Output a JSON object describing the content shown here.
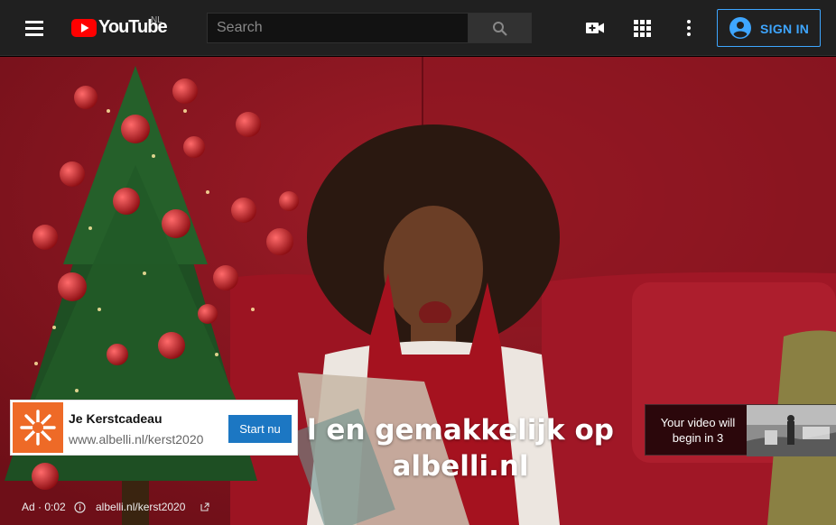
{
  "masthead": {
    "logo_text": "YouTube",
    "country_code": "NL",
    "search_placeholder": "Search",
    "signin_label": "SIGN IN",
    "icons": {
      "menu": "hamburger-menu-icon",
      "search": "search-icon",
      "create": "video-camera-plus-icon",
      "apps": "apps-grid-icon",
      "settings": "vertical-dots-icon",
      "account": "account-circle-icon"
    }
  },
  "player": {
    "subtitle_line1": "l en gemakkelijk op",
    "subtitle_line2": "albelli.nl",
    "ad_card": {
      "title": "Je Kerstcadeau",
      "url": "www.albelli.nl/kerst2020",
      "cta_label": "Start nu",
      "thumb_icon": "albelli-logo-icon"
    },
    "skip": {
      "text": "Your video will begin in 3"
    },
    "ad_info": {
      "label": "Ad · 0:02",
      "link": "albelli.nl/kerst2020",
      "info_icon": "info-icon",
      "external_icon": "external-link-icon"
    }
  },
  "colors": {
    "masthead_bg": "#202020",
    "accent_blue": "#3ea6ff",
    "youtube_red": "#ff0000",
    "cta_blue": "#1c77c3",
    "ad_thumb_orange": "#ee6a27",
    "backdrop_red": "#8a1722"
  }
}
